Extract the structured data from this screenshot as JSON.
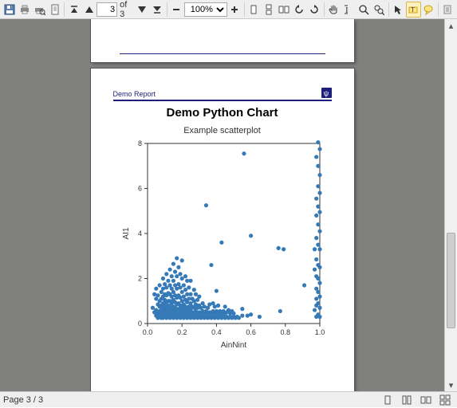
{
  "toolbar": {
    "page_current": "3",
    "page_total": "of 3",
    "zoom": "100%"
  },
  "report": {
    "header_title": "Demo Report",
    "chart_title": "Demo Python Chart",
    "chart_subtitle": "Example scatterplot",
    "xlabel": "AinNint",
    "ylabel": "AI1"
  },
  "status": {
    "page_indicator": "Page 3 / 3"
  },
  "chart_data": {
    "type": "scatter",
    "title": "Example scatterplot",
    "xlabel": "AinNint",
    "ylabel": "AI1",
    "xlim": [
      0.0,
      1.0
    ],
    "ylim": [
      0,
      8
    ],
    "xticks": [
      0.0,
      0.2,
      0.4,
      0.6,
      0.8,
      1.0
    ],
    "yticks": [
      0,
      2,
      4,
      6,
      8
    ],
    "points": [
      [
        0.03,
        0.7
      ],
      [
        0.04,
        0.5
      ],
      [
        0.04,
        1.3
      ],
      [
        0.05,
        0.35
      ],
      [
        0.05,
        0.6
      ],
      [
        0.05,
        1.1
      ],
      [
        0.05,
        1.55
      ],
      [
        0.06,
        0.25
      ],
      [
        0.06,
        0.45
      ],
      [
        0.06,
        0.85
      ],
      [
        0.06,
        1.25
      ],
      [
        0.07,
        0.3
      ],
      [
        0.07,
        0.55
      ],
      [
        0.07,
        0.75
      ],
      [
        0.07,
        1.0
      ],
      [
        0.07,
        1.7
      ],
      [
        0.08,
        0.25
      ],
      [
        0.08,
        0.4
      ],
      [
        0.08,
        0.6
      ],
      [
        0.08,
        0.8
      ],
      [
        0.08,
        1.1
      ],
      [
        0.08,
        1.4
      ],
      [
        0.09,
        0.25
      ],
      [
        0.09,
        0.35
      ],
      [
        0.09,
        0.5
      ],
      [
        0.09,
        0.65
      ],
      [
        0.09,
        0.9
      ],
      [
        0.09,
        1.2
      ],
      [
        0.09,
        1.55
      ],
      [
        0.09,
        2.0
      ],
      [
        0.1,
        0.3
      ],
      [
        0.1,
        0.45
      ],
      [
        0.1,
        0.6
      ],
      [
        0.1,
        0.8
      ],
      [
        0.1,
        1.05
      ],
      [
        0.1,
        1.3
      ],
      [
        0.1,
        1.75
      ],
      [
        0.11,
        0.25
      ],
      [
        0.11,
        0.4
      ],
      [
        0.11,
        0.55
      ],
      [
        0.11,
        0.7
      ],
      [
        0.11,
        0.95
      ],
      [
        0.11,
        1.25
      ],
      [
        0.11,
        1.6
      ],
      [
        0.11,
        2.2
      ],
      [
        0.12,
        0.3
      ],
      [
        0.12,
        0.45
      ],
      [
        0.12,
        0.6
      ],
      [
        0.12,
        0.8
      ],
      [
        0.12,
        1.0
      ],
      [
        0.12,
        1.35
      ],
      [
        0.12,
        1.9
      ],
      [
        0.13,
        0.25
      ],
      [
        0.13,
        0.4
      ],
      [
        0.13,
        0.55
      ],
      [
        0.13,
        0.75
      ],
      [
        0.13,
        1.0
      ],
      [
        0.13,
        1.3
      ],
      [
        0.13,
        1.7
      ],
      [
        0.13,
        2.4
      ],
      [
        0.14,
        0.3
      ],
      [
        0.14,
        0.45
      ],
      [
        0.14,
        0.65
      ],
      [
        0.14,
        0.9
      ],
      [
        0.14,
        1.2
      ],
      [
        0.14,
        1.55
      ],
      [
        0.14,
        2.1
      ],
      [
        0.15,
        0.25
      ],
      [
        0.15,
        0.4
      ],
      [
        0.15,
        0.55
      ],
      [
        0.15,
        0.75
      ],
      [
        0.15,
        1.05
      ],
      [
        0.15,
        1.4
      ],
      [
        0.15,
        1.9
      ],
      [
        0.15,
        2.65
      ],
      [
        0.16,
        0.3
      ],
      [
        0.16,
        0.5
      ],
      [
        0.16,
        0.7
      ],
      [
        0.16,
        0.95
      ],
      [
        0.16,
        1.25
      ],
      [
        0.16,
        1.7
      ],
      [
        0.16,
        2.3
      ],
      [
        0.17,
        0.25
      ],
      [
        0.17,
        0.4
      ],
      [
        0.17,
        0.6
      ],
      [
        0.17,
        0.85
      ],
      [
        0.17,
        1.15
      ],
      [
        0.17,
        1.55
      ],
      [
        0.17,
        2.1
      ],
      [
        0.17,
        2.9
      ],
      [
        0.18,
        0.3
      ],
      [
        0.18,
        0.45
      ],
      [
        0.18,
        0.65
      ],
      [
        0.18,
        0.9
      ],
      [
        0.18,
        1.25
      ],
      [
        0.18,
        1.75
      ],
      [
        0.18,
        2.5
      ],
      [
        0.19,
        0.25
      ],
      [
        0.19,
        0.4
      ],
      [
        0.19,
        0.6
      ],
      [
        0.19,
        0.8
      ],
      [
        0.19,
        1.15
      ],
      [
        0.19,
        1.6
      ],
      [
        0.19,
        2.2
      ],
      [
        0.2,
        0.3
      ],
      [
        0.2,
        0.5
      ],
      [
        0.2,
        0.7
      ],
      [
        0.2,
        1.0
      ],
      [
        0.2,
        1.4
      ],
      [
        0.2,
        2.0
      ],
      [
        0.2,
        2.8
      ],
      [
        0.21,
        0.25
      ],
      [
        0.21,
        0.4
      ],
      [
        0.21,
        0.6
      ],
      [
        0.21,
        0.85
      ],
      [
        0.21,
        1.2
      ],
      [
        0.21,
        1.7
      ],
      [
        0.22,
        0.3
      ],
      [
        0.22,
        0.5
      ],
      [
        0.22,
        0.75
      ],
      [
        0.22,
        1.05
      ],
      [
        0.22,
        1.5
      ],
      [
        0.22,
        2.1
      ],
      [
        0.23,
        0.25
      ],
      [
        0.23,
        0.45
      ],
      [
        0.23,
        0.65
      ],
      [
        0.23,
        0.95
      ],
      [
        0.23,
        1.3
      ],
      [
        0.23,
        1.9
      ],
      [
        0.24,
        0.3
      ],
      [
        0.24,
        0.5
      ],
      [
        0.24,
        0.75
      ],
      [
        0.24,
        1.1
      ],
      [
        0.24,
        1.6
      ],
      [
        0.25,
        0.25
      ],
      [
        0.25,
        0.4
      ],
      [
        0.25,
        0.6
      ],
      [
        0.25,
        0.9
      ],
      [
        0.25,
        1.3
      ],
      [
        0.25,
        1.9
      ],
      [
        0.26,
        0.3
      ],
      [
        0.26,
        0.5
      ],
      [
        0.26,
        0.75
      ],
      [
        0.26,
        1.1
      ],
      [
        0.27,
        0.25
      ],
      [
        0.27,
        0.45
      ],
      [
        0.27,
        0.7
      ],
      [
        0.27,
        1.0
      ],
      [
        0.27,
        1.5
      ],
      [
        0.28,
        0.3
      ],
      [
        0.28,
        0.55
      ],
      [
        0.28,
        0.85
      ],
      [
        0.28,
        1.3
      ],
      [
        0.29,
        0.25
      ],
      [
        0.29,
        0.45
      ],
      [
        0.29,
        0.7
      ],
      [
        0.29,
        1.05
      ],
      [
        0.3,
        0.3
      ],
      [
        0.3,
        0.5
      ],
      [
        0.3,
        0.8
      ],
      [
        0.3,
        1.2
      ],
      [
        0.31,
        0.25
      ],
      [
        0.31,
        0.45
      ],
      [
        0.31,
        0.7
      ],
      [
        0.32,
        0.3
      ],
      [
        0.32,
        0.55
      ],
      [
        0.32,
        0.9
      ],
      [
        0.33,
        0.25
      ],
      [
        0.33,
        0.45
      ],
      [
        0.33,
        0.75
      ],
      [
        0.34,
        0.3
      ],
      [
        0.34,
        0.55
      ],
      [
        0.34,
        5.25
      ],
      [
        0.35,
        0.25
      ],
      [
        0.35,
        0.45
      ],
      [
        0.35,
        0.7
      ],
      [
        0.36,
        0.3
      ],
      [
        0.36,
        0.5
      ],
      [
        0.36,
        0.85
      ],
      [
        0.37,
        0.25
      ],
      [
        0.37,
        0.45
      ],
      [
        0.37,
        2.6
      ],
      [
        0.38,
        0.3
      ],
      [
        0.38,
        0.55
      ],
      [
        0.38,
        0.9
      ],
      [
        0.39,
        0.25
      ],
      [
        0.39,
        0.45
      ],
      [
        0.39,
        0.75
      ],
      [
        0.4,
        0.3
      ],
      [
        0.4,
        0.55
      ],
      [
        0.4,
        1.45
      ],
      [
        0.41,
        0.25
      ],
      [
        0.41,
        0.45
      ],
      [
        0.41,
        0.8
      ],
      [
        0.42,
        0.3
      ],
      [
        0.42,
        0.55
      ],
      [
        0.43,
        0.25
      ],
      [
        0.43,
        0.45
      ],
      [
        0.43,
        3.6
      ],
      [
        0.44,
        0.3
      ],
      [
        0.44,
        0.55
      ],
      [
        0.45,
        0.25
      ],
      [
        0.45,
        0.45
      ],
      [
        0.45,
        0.75
      ],
      [
        0.46,
        0.3
      ],
      [
        0.46,
        0.5
      ],
      [
        0.47,
        0.25
      ],
      [
        0.47,
        0.6
      ],
      [
        0.48,
        0.3
      ],
      [
        0.48,
        0.45
      ],
      [
        0.49,
        0.25
      ],
      [
        0.49,
        0.55
      ],
      [
        0.5,
        0.3
      ],
      [
        0.5,
        0.45
      ],
      [
        0.51,
        0.25
      ],
      [
        0.52,
        0.3
      ],
      [
        0.53,
        0.25
      ],
      [
        0.55,
        0.35
      ],
      [
        0.55,
        0.65
      ],
      [
        0.56,
        7.55
      ],
      [
        0.58,
        0.35
      ],
      [
        0.6,
        0.4
      ],
      [
        0.6,
        3.9
      ],
      [
        0.65,
        0.3
      ],
      [
        0.76,
        3.35
      ],
      [
        0.77,
        0.55
      ],
      [
        0.79,
        3.3
      ],
      [
        0.91,
        1.7
      ],
      [
        0.97,
        0.6
      ],
      [
        0.97,
        2.4
      ],
      [
        0.97,
        3.3
      ],
      [
        0.98,
        0.3
      ],
      [
        0.98,
        0.8
      ],
      [
        0.98,
        1.1
      ],
      [
        0.98,
        1.55
      ],
      [
        0.98,
        2.1
      ],
      [
        0.98,
        2.85
      ],
      [
        0.98,
        3.8
      ],
      [
        0.98,
        4.8
      ],
      [
        0.98,
        5.55
      ],
      [
        0.98,
        7.4
      ],
      [
        0.99,
        0.4
      ],
      [
        0.99,
        0.9
      ],
      [
        0.99,
        1.4
      ],
      [
        0.99,
        2.0
      ],
      [
        0.99,
        2.6
      ],
      [
        0.99,
        3.5
      ],
      [
        0.99,
        4.4
      ],
      [
        0.99,
        5.2
      ],
      [
        0.99,
        6.1
      ],
      [
        0.99,
        7.0
      ],
      [
        0.99,
        8.05
      ],
      [
        1.0,
        0.3
      ],
      [
        1.0,
        0.7
      ],
      [
        1.0,
        1.2
      ],
      [
        1.0,
        1.8
      ],
      [
        1.0,
        2.5
      ],
      [
        1.0,
        3.3
      ],
      [
        1.0,
        4.1
      ],
      [
        1.0,
        4.95
      ],
      [
        1.0,
        5.8
      ],
      [
        1.0,
        6.6
      ],
      [
        1.0,
        7.75
      ],
      [
        1.0,
        8.4
      ]
    ]
  }
}
